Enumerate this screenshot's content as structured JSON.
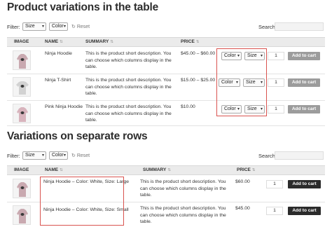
{
  "section1": {
    "title": "Product variations in the table",
    "filter_label": "Filter:",
    "filter_size": "Size",
    "filter_color": "Color",
    "reset_label": "Reset",
    "search_label": "Search:",
    "headers": {
      "image": "IMAGE",
      "name": "NAME",
      "summary": "SUMMARY",
      "price": "PRICE"
    },
    "rows": [
      {
        "name": "Ninja Hoodie",
        "summary": "This is the product short description. You can choose which columns display in the table.",
        "price": "$45.00 – $60.00",
        "color_select": "Color",
        "size_select": "Size",
        "qty": "1",
        "button": "Add to cart"
      },
      {
        "name": "Ninja T-Shirt",
        "summary": "This is the product short description. You can choose which columns display in the table.",
        "price": "$15.00 – $25.00",
        "color_select": "Color",
        "size_select": "Size",
        "qty": "1",
        "button": "Add to cart"
      },
      {
        "name": "Pink Ninja Hoodie",
        "summary": "This is the product short description. You can choose which columns display in the table.",
        "price": "$10.00",
        "color_select": "Color",
        "size_select": "Size",
        "qty": "1",
        "button": "Add to cart"
      }
    ]
  },
  "section2": {
    "title": "Variations on separate rows",
    "filter_label": "Filter:",
    "filter_size": "Size",
    "filter_color": "Color",
    "reset_label": "Reset",
    "search_label": "Search:",
    "headers": {
      "image": "IMAGE",
      "name": "NAME",
      "summary": "SUMMARY",
      "price": "PRICE"
    },
    "rows": [
      {
        "name": "Ninja Hoodie – Color: White, Size: Large",
        "summary": "This is the product short description. You can choose which columns display in the table.",
        "price": "$60.00",
        "qty": "1",
        "button": "Add to cart"
      },
      {
        "name": "Ninja Hoodie – Color: White, Size: Small",
        "summary": "This is the product short description. You can choose which columns display in the table.",
        "price": "$45.00",
        "qty": "1",
        "button": "Add to cart"
      }
    ]
  },
  "colors": {
    "highlight": "#d9534f",
    "button_grey": "#9c9c9c",
    "button_dark": "#2b2b2b",
    "header_bg": "#ebebeb"
  },
  "icons": {
    "reset": "reset-icon",
    "sort": "sort-icon",
    "chevron": "chevron-down-icon"
  }
}
